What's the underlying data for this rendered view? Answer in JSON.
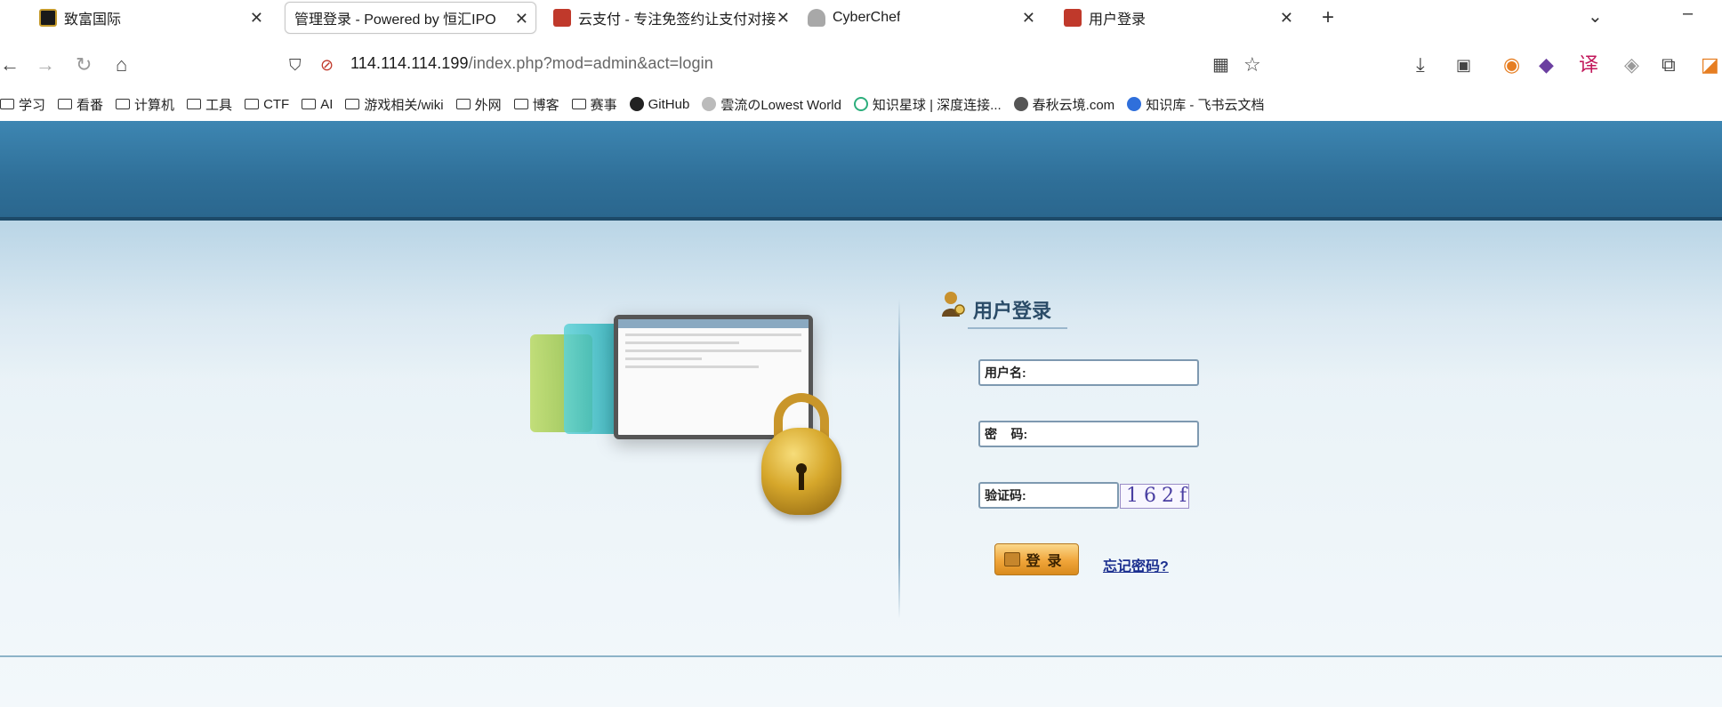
{
  "tabs": [
    {
      "title": "致富国际",
      "favicon_color": "#1a1a1a"
    },
    {
      "title": "管理登录 - Powered by 恒汇IPO",
      "favicon_color": ""
    },
    {
      "title": "云支付 - 专注免签约让支付对接",
      "favicon_color": "#c0392b"
    },
    {
      "title": "CyberChef",
      "favicon_color": "#9a9a9a"
    },
    {
      "title": "用户登录",
      "favicon_color": "#c0392b"
    }
  ],
  "address": {
    "host": "114.114.114.199",
    "path": "/index.php?mod=admin&act=login"
  },
  "bookmarks": [
    {
      "label": "学习",
      "icon": "folder-icon"
    },
    {
      "label": "看番",
      "icon": "folder-icon"
    },
    {
      "label": "计算机",
      "icon": "folder-icon"
    },
    {
      "label": "工具",
      "icon": "folder-icon"
    },
    {
      "label": "CTF",
      "icon": "folder-icon"
    },
    {
      "label": "AI",
      "icon": "folder-icon"
    },
    {
      "label": "游戏相关/wiki",
      "icon": "folder-icon"
    },
    {
      "label": "外网",
      "icon": "folder-icon"
    },
    {
      "label": "博客",
      "icon": "folder-icon"
    },
    {
      "label": "赛事",
      "icon": "folder-icon"
    },
    {
      "label": "GitHub",
      "icon": "github-icon"
    },
    {
      "label": "雲流のLowest World",
      "icon": "site-icon"
    },
    {
      "label": "知识星球 | 深度连接...",
      "icon": "zsxq-icon"
    },
    {
      "label": "春秋云境.com",
      "icon": "site-icon"
    },
    {
      "label": "知识库 - 飞书云文档",
      "icon": "feishu-icon"
    }
  ],
  "login": {
    "title": "用户登录",
    "username_label": "用户名:",
    "password_label": "密    码:",
    "captcha_label": "验证码:",
    "captcha_text": "162f",
    "submit_label": "登录",
    "forgot_label": "忘记密码?"
  },
  "colors": {
    "banner": "#2f6f98",
    "link": "#1b2f8f",
    "button": "#f0a53a"
  }
}
